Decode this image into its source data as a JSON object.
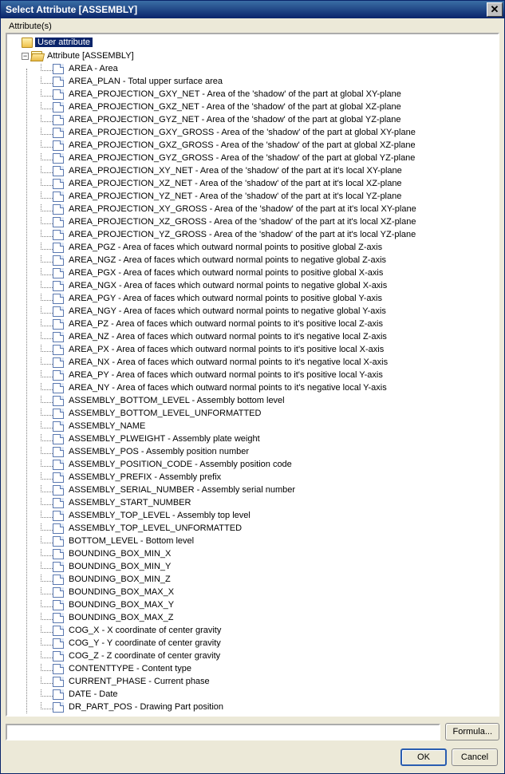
{
  "title": "Select Attribute [ASSEMBLY]",
  "fieldset_label": "Attribute(s)",
  "tree": {
    "user_attribute": {
      "label": "User attribute"
    },
    "assembly_attribute": {
      "label": "Attribute [ASSEMBLY]"
    },
    "items": [
      "AREA  -  Area",
      "AREA_PLAN  -  Total upper surface area",
      "AREA_PROJECTION_GXY_NET  -  Area of the 'shadow' of the part at global XY-plane",
      "AREA_PROJECTION_GXZ_NET  -  Area of the 'shadow' of the part at global XZ-plane",
      "AREA_PROJECTION_GYZ_NET  -  Area of the 'shadow' of the part at global YZ-plane",
      "AREA_PROJECTION_GXY_GROSS  -  Area of the 'shadow' of the part at global XY-plane",
      "AREA_PROJECTION_GXZ_GROSS  -  Area of the 'shadow' of the part at global XZ-plane",
      "AREA_PROJECTION_GYZ_GROSS  -  Area of the 'shadow' of the part at global YZ-plane",
      "AREA_PROJECTION_XY_NET  -  Area of the 'shadow' of the part at it's local XY-plane",
      "AREA_PROJECTION_XZ_NET  -  Area of the 'shadow' of the part at it's local XZ-plane",
      "AREA_PROJECTION_YZ_NET  -  Area of the 'shadow' of the part at it's local YZ-plane",
      "AREA_PROJECTION_XY_GROSS  -  Area of the 'shadow' of the part at it's local XY-plane",
      "AREA_PROJECTION_XZ_GROSS  -  Area of the 'shadow' of the part at it's local XZ-plane",
      "AREA_PROJECTION_YZ_GROSS  -  Area of the 'shadow' of the part at it's local YZ-plane",
      "AREA_PGZ  -  Area of faces which outward normal points to positive global Z-axis",
      "AREA_NGZ  -  Area of faces which outward normal points to negative global Z-axis",
      "AREA_PGX  -  Area of faces which outward normal points to positive global X-axis",
      "AREA_NGX  -  Area of faces which outward normal points to negative global X-axis",
      "AREA_PGY  -  Area of faces which outward normal points to positive global Y-axis",
      "AREA_NGY  -  Area of faces which outward normal points to negative global Y-axis",
      "AREA_PZ  -  Area of faces which outward normal points to it's positive local Z-axis",
      "AREA_NZ  -  Area of faces which outward normal points to it's negative local Z-axis",
      "AREA_PX  -  Area of faces which outward normal points to it's positive local X-axis",
      "AREA_NX  -  Area of faces which outward normal points to it's negative local X-axis",
      "AREA_PY  -  Area of faces which outward normal points to it's positive local Y-axis",
      "AREA_NY  -  Area of faces which outward normal points to it's negative local Y-axis",
      "ASSEMBLY_BOTTOM_LEVEL  -  Assembly bottom level",
      "ASSEMBLY_BOTTOM_LEVEL_UNFORMATTED",
      "ASSEMBLY_NAME",
      "ASSEMBLY_PLWEIGHT  -  Assembly plate weight",
      "ASSEMBLY_POS  -  Assembly position number",
      "ASSEMBLY_POSITION_CODE  -  Assembly position code",
      "ASSEMBLY_PREFIX  -  Assembly prefix",
      "ASSEMBLY_SERIAL_NUMBER  -  Assembly serial number",
      "ASSEMBLY_START_NUMBER",
      "ASSEMBLY_TOP_LEVEL  -  Assembly top level",
      "ASSEMBLY_TOP_LEVEL_UNFORMATTED",
      "BOTTOM_LEVEL  -  Bottom level",
      "BOUNDING_BOX_MIN_X",
      "BOUNDING_BOX_MIN_Y",
      "BOUNDING_BOX_MIN_Z",
      "BOUNDING_BOX_MAX_X",
      "BOUNDING_BOX_MAX_Y",
      "BOUNDING_BOX_MAX_Z",
      "COG_X  -  X coordinate of center gravity",
      "COG_Y  -  Y coordinate of center gravity",
      "COG_Z  -  Z coordinate of center gravity",
      "CONTENTTYPE  -  Content type",
      "CURRENT_PHASE  -  Current phase",
      "DATE  -  Date",
      "DR_PART_POS  -  Drawing Part position"
    ]
  },
  "input_value": "",
  "buttons": {
    "formula": "Formula...",
    "ok": "OK",
    "cancel": "Cancel"
  }
}
